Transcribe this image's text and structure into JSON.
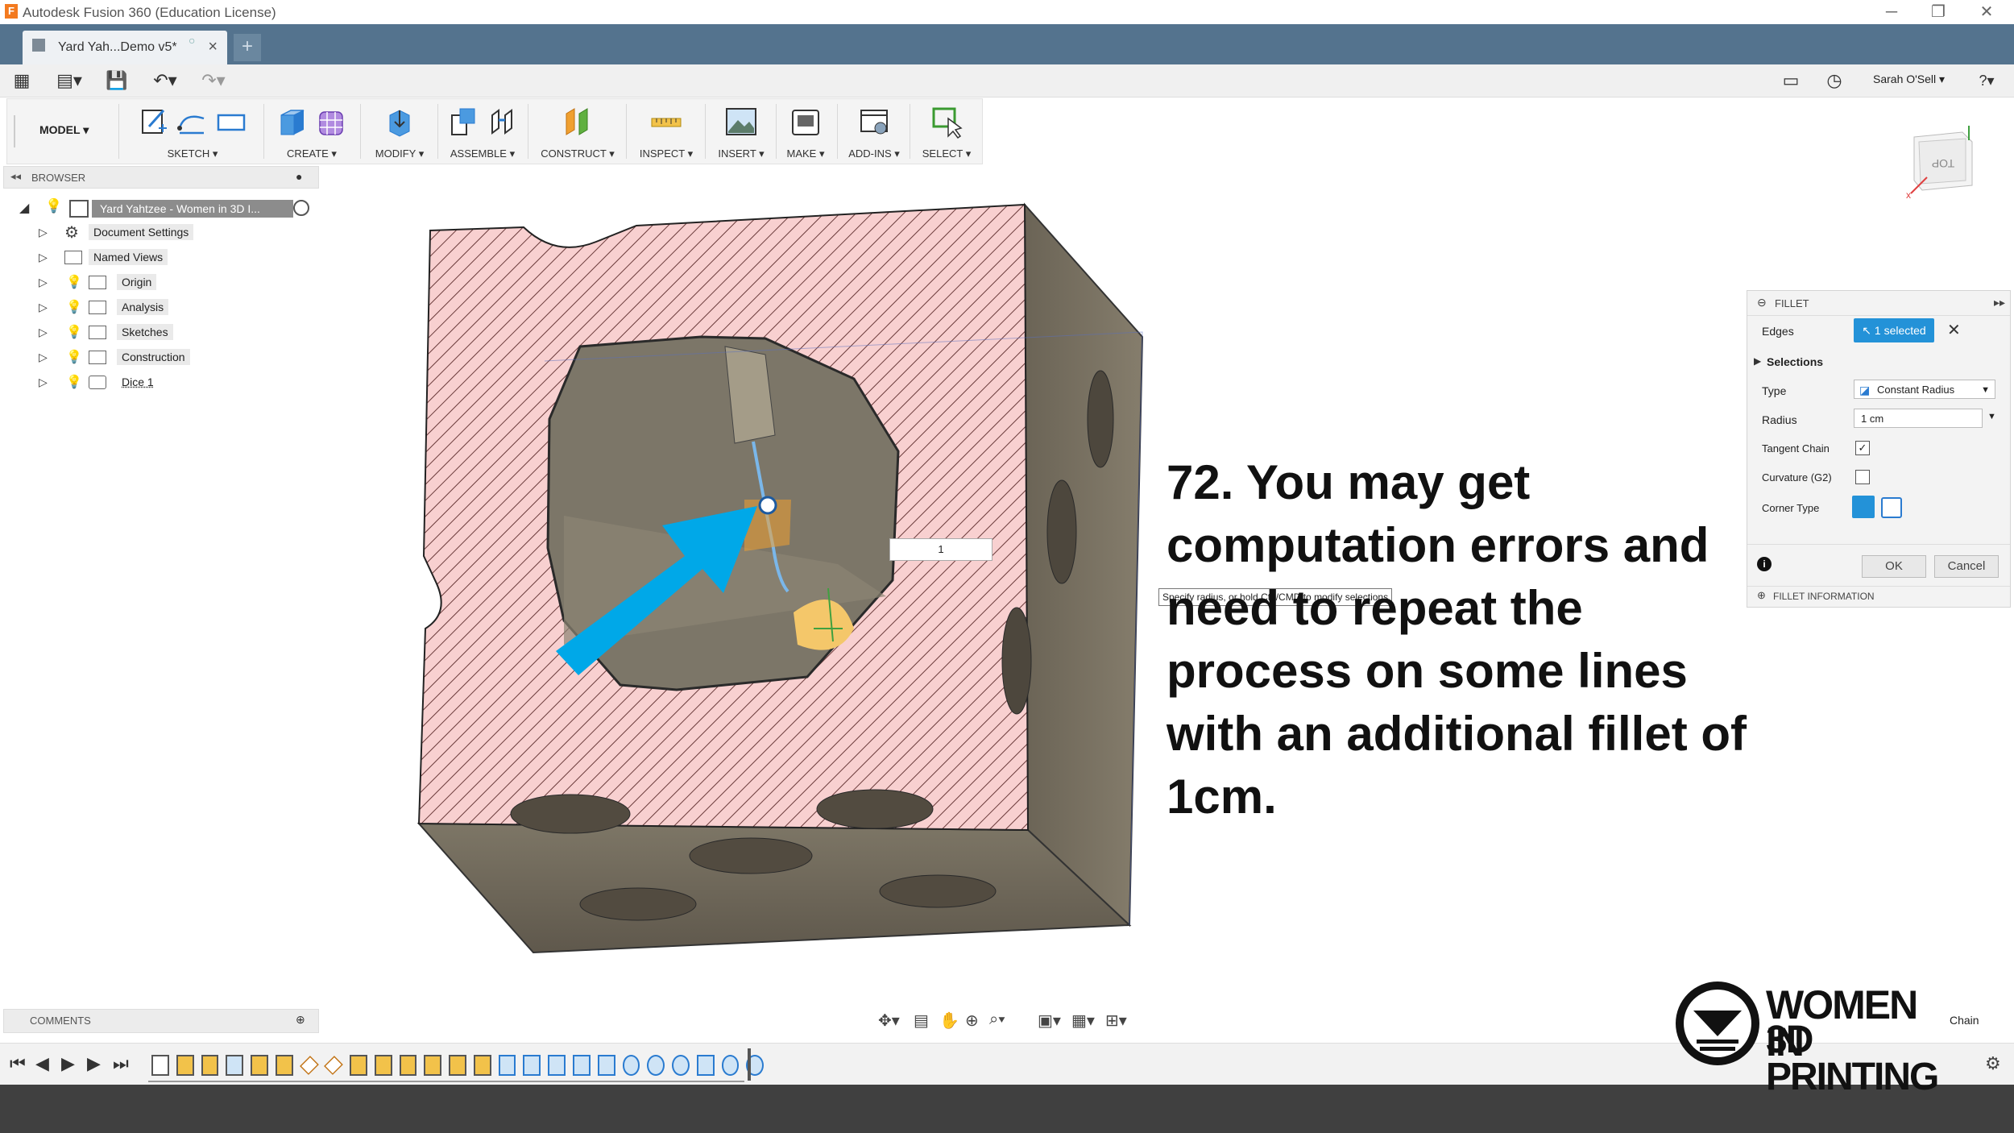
{
  "window": {
    "app_title": "Autodesk Fusion 360 (Education License)",
    "app_logo": "F",
    "minimize": "─",
    "restore": "❐",
    "close": "✕"
  },
  "tabs": {
    "active_tab": "Yard Yah...Demo v5*",
    "close": "×",
    "new_tab": "+"
  },
  "quick_access": {
    "user_name": "Sarah O'Sell ▾",
    "help": "?▾"
  },
  "toolbar": {
    "workspace": "MODEL ▾",
    "groups": [
      {
        "label": "SKETCH ▾"
      },
      {
        "label": "CREATE ▾"
      },
      {
        "label": "MODIFY ▾"
      },
      {
        "label": "ASSEMBLE ▾"
      },
      {
        "label": "CONSTRUCT ▾"
      },
      {
        "label": "INSPECT ▾"
      },
      {
        "label": "INSERT ▾"
      },
      {
        "label": "MAKE ▾"
      },
      {
        "label": "ADD-INS ▾"
      },
      {
        "label": "SELECT ▾"
      }
    ]
  },
  "browser": {
    "title": "BROWSER",
    "root": "Yard Yahtzee - Women in 3D I...",
    "items": [
      {
        "label": "Document Settings"
      },
      {
        "label": "Named Views"
      },
      {
        "label": "Origin"
      },
      {
        "label": "Analysis"
      },
      {
        "label": "Sketches"
      },
      {
        "label": "Construction"
      },
      {
        "label": "Dice 1"
      }
    ]
  },
  "viewcube": {
    "face": "TOP"
  },
  "canvas": {
    "radius_value": "1",
    "tooltip": "Specify radius, or hold Ctrl/CMD to modify selections"
  },
  "fillet_panel": {
    "title": "FILLET",
    "edges_label": "Edges",
    "edges_value": "1 selected",
    "selections_label": "Selections",
    "type_label": "Type",
    "type_value": "Constant Radius",
    "radius_label": "Radius",
    "radius_value": "1 cm",
    "tangent_label": "Tangent Chain",
    "curvature_label": "Curvature (G2)",
    "corner_label": "Corner Type",
    "ok": "OK",
    "cancel": "Cancel",
    "info": "FILLET INFORMATION"
  },
  "instruction": {
    "text": "72. You may get computation errors and need to repeat the process on some lines with an additional fillet of 1cm."
  },
  "comments": {
    "title": "COMMENTS"
  },
  "watermark": {
    "line1": "WOMEN IN",
    "line2": "3D PRINTING"
  },
  "chain_label": "Chain",
  "colors": {
    "tab_bar": "#54738e",
    "accent": "#2392d8",
    "arrow": "#00a8e8",
    "section_fill": "#f6caca",
    "body": "#6d6658"
  }
}
